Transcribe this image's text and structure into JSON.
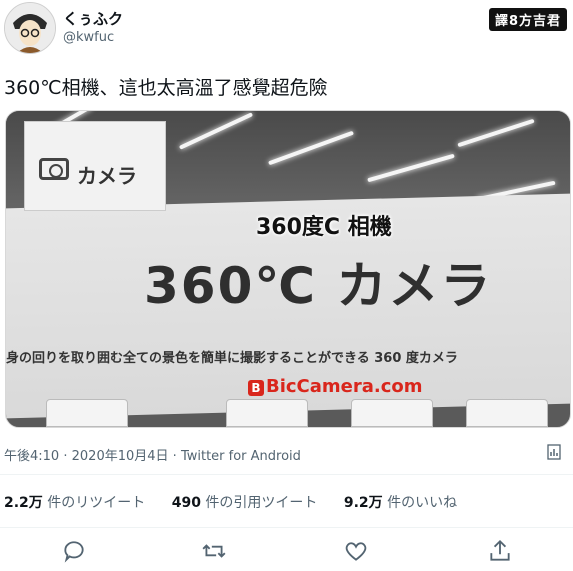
{
  "user": {
    "name": "くぅふク",
    "handle": "@kwfuc"
  },
  "translator_badge": "譯8方吉君",
  "tweet": {
    "text": "360℃相機、這也太高溫了感覺超危險"
  },
  "media": {
    "overlay_caption": "360度C 相機",
    "big_sign_text": "360℃ カメラ",
    "camera_sign_text": "カメラ",
    "banner_subtext": "身の回りを取り囲む全ての景色を簡単に撮影することができる 360 度カメラ",
    "logo_text": "BicCamera.com",
    "logo_mark": "B"
  },
  "meta": {
    "time": "午後4:10",
    "separator": "·",
    "date": "2020年10月4日",
    "source": "Twitter for Android"
  },
  "stats": {
    "retweets_count": "2.2万",
    "retweets_label": "件のリツイート",
    "quotes_count": "490",
    "quotes_label": "件の引用ツイート",
    "likes_count": "9.2万",
    "likes_label": "件のいいね"
  },
  "colors": {
    "text_primary": "#0f1419",
    "text_secondary": "#536471",
    "logo_red": "#d9261c"
  },
  "icons": [
    "reply-icon",
    "retweet-icon",
    "like-icon",
    "share-icon",
    "analytics-icon"
  ]
}
